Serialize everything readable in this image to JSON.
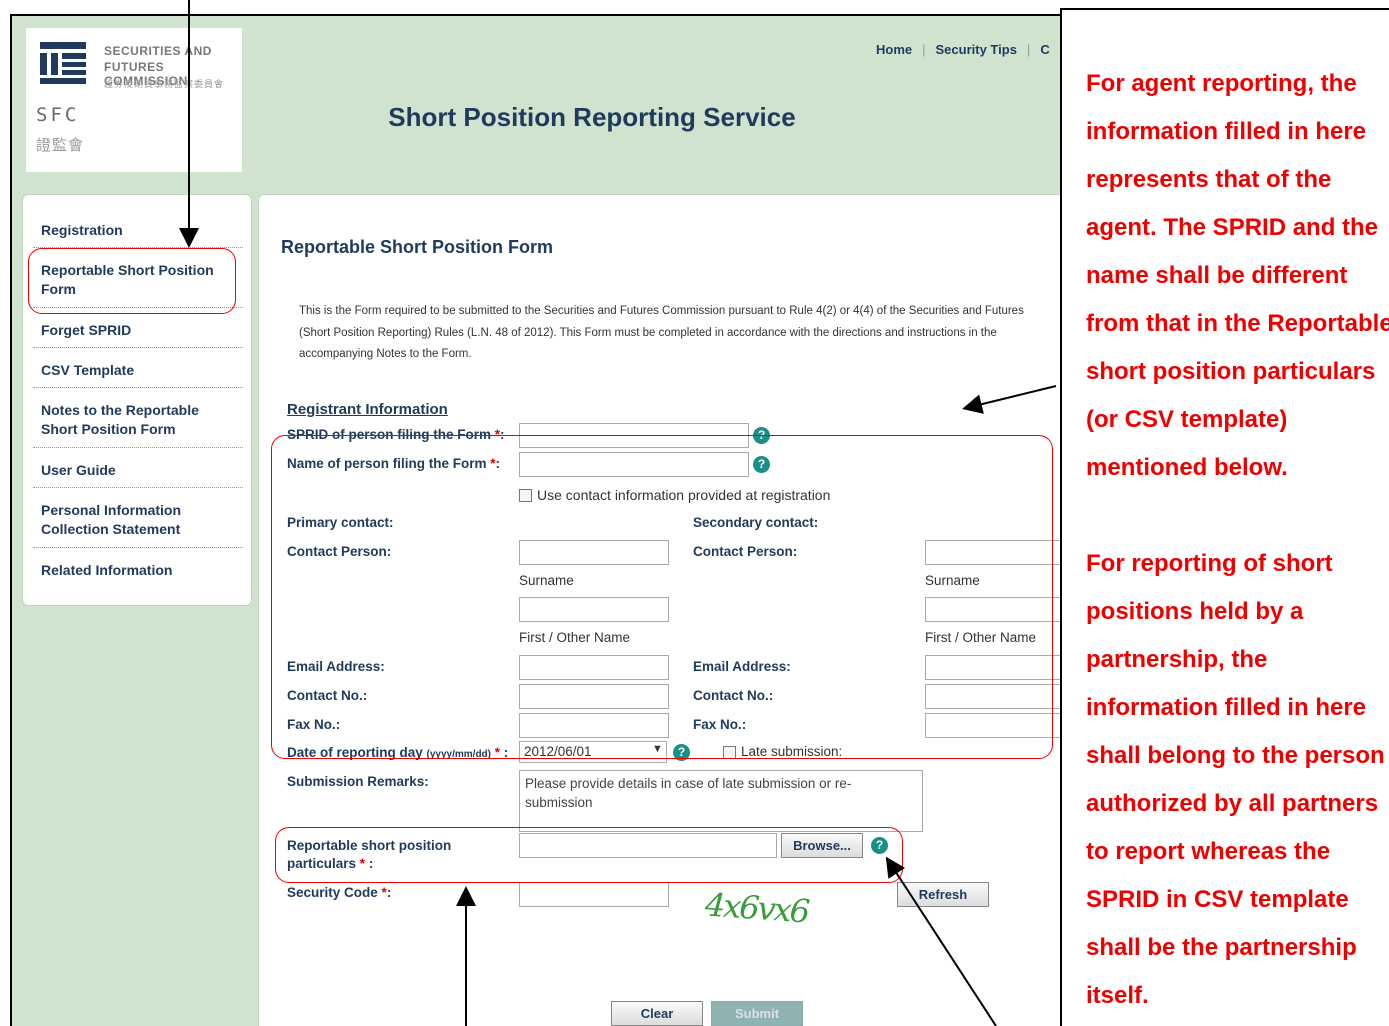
{
  "logo": {
    "line1": "SECURITIES AND",
    "line2": "FUTURES COMMISSION",
    "line3": "證券及期貨事務監察委員會",
    "abbr": "SFC",
    "abbr_cn": "證監會"
  },
  "site_title": "Short Position Reporting Service",
  "top_nav": {
    "home": "Home",
    "security_tips": "Security Tips",
    "extra": "C"
  },
  "sidebar": {
    "items": [
      {
        "label": "Registration"
      },
      {
        "label": "Reportable Short Position Form"
      },
      {
        "label": "Forget SPRID"
      },
      {
        "label": "CSV Template"
      },
      {
        "label": "Notes to the Reportable Short Position Form"
      },
      {
        "label": "User Guide"
      },
      {
        "label": "Personal Information Collection Statement"
      },
      {
        "label": "Related Information"
      }
    ]
  },
  "form": {
    "title": "Reportable Short Position Form",
    "intro": "This is the Form required to be submitted to the Securities and Futures Commission pursuant to Rule 4(2) or 4(4) of the Securities and Futures (Short Position Reporting) Rules (L.N. 48 of 2012). This Form must be completed in accordance with the directions and instructions in the accompanying Notes to the Form.",
    "registrant_info": "Registrant Information",
    "sprid_label": "SPRID of person filing the Form",
    "name_label": "Name of person filing the Form",
    "use_contact_label": "Use contact information provided at registration",
    "primary_contact": "Primary contact:",
    "secondary_contact": "Secondary contact:",
    "contact_person": "Contact Person:",
    "surname": "Surname",
    "first_name": "First / Other Name",
    "email": "Email Address:",
    "contact_no": "Contact No.:",
    "fax_no": "Fax No.:",
    "date_label": "Date of reporting day",
    "date_format": "(yyyy/mm/dd)",
    "date_value": "2012/06/01",
    "late_submission": "Late submission:",
    "remarks_label": "Submission Remarks:",
    "remarks_value": "Please provide details in case of late submission or re-submission",
    "particulars_label_1": "Reportable short position",
    "particulars_label_2": "particulars",
    "browse": "Browse...",
    "security_code": "Security Code",
    "captcha_text": "4x6vx6",
    "refresh": "Refresh",
    "clear": "Clear",
    "submit": "Submit",
    "required_mark": "*",
    "colon": ":"
  },
  "annotation": {
    "text": "For agent reporting, the information filled in here represents that of the agent. The SPRID and the name shall be different from that in the Reportable short position particulars (or CSV template) mentioned below.",
    "text2": "For reporting of short positions held by a partnership, the information filled in here shall belong to the person authorized by all partners to report whereas the SPRID in CSV template shall be the partnership itself."
  },
  "colors": {
    "annotation_red": "#e00000",
    "navy": "#1f3a5c",
    "header_green": "#cfe3cf",
    "help_teal": "#1a8f8a"
  }
}
